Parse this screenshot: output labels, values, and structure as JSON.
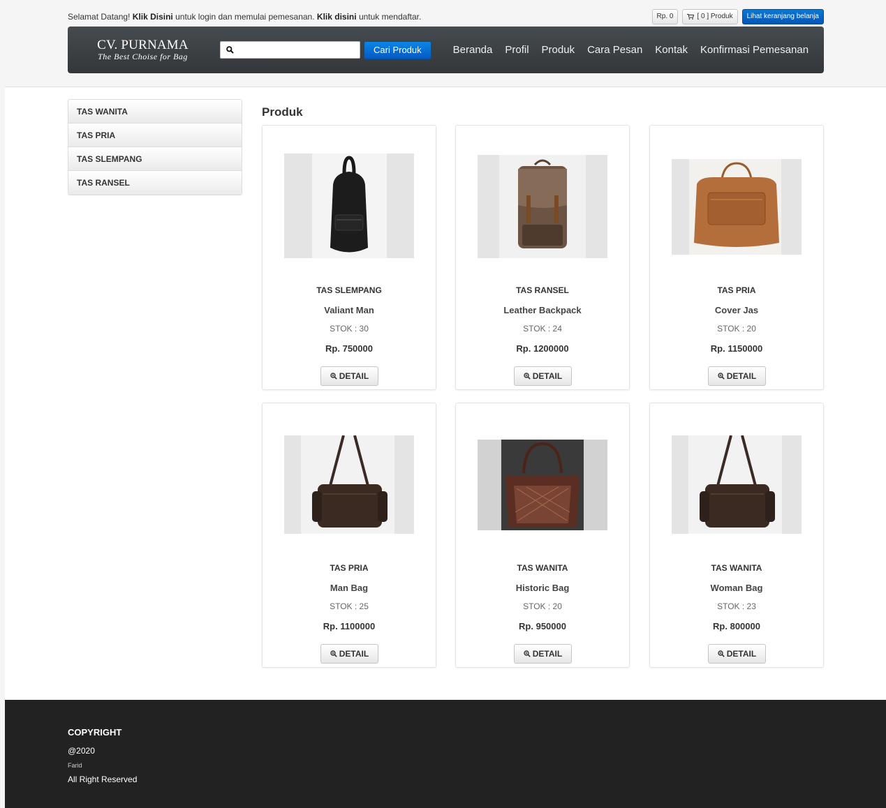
{
  "topbar": {
    "welcome_prefix": "Selamat Datang!",
    "login_link": "Klik Disini",
    "login_suffix": "untuk login dan memulai pemesanan.",
    "register_link": "Klik disini",
    "register_suffix": "untuk mendaftar.",
    "cart_total": "Rp. 0",
    "cart_count": "[ 0 ] Produk",
    "view_cart": "Lihat keranjang belanja"
  },
  "navbar": {
    "brand_name": "CV. PURNAMA",
    "brand_tagline": "The Best Choise for Bag",
    "search_value": "",
    "search_placeholder": "",
    "search_button": "Cari Produk",
    "links": [
      "Beranda",
      "Profil",
      "Produk",
      "Cara Pesan",
      "Kontak",
      "Konfirmasi Pemesanan"
    ]
  },
  "sidebar": {
    "items": [
      "TAS WANITA",
      "TAS PRIA",
      "TAS SLEMPANG",
      "TAS RANSEL"
    ]
  },
  "main": {
    "title": "Produk",
    "detail_label": "DETAIL",
    "products": [
      {
        "category": "TAS SLEMPANG",
        "name": "Valiant Man",
        "stock": "STOK : 30",
        "price": "Rp. 750000"
      },
      {
        "category": "TAS RANSEL",
        "name": "Leather Backpack",
        "stock": "STOK : 24",
        "price": "Rp. 1200000"
      },
      {
        "category": "TAS PRIA",
        "name": "Cover Jas",
        "stock": "STOK : 20",
        "price": "Rp. 1150000"
      },
      {
        "category": "TAS PRIA",
        "name": "Man Bag",
        "stock": "STOK : 25",
        "price": "Rp. 1100000"
      },
      {
        "category": "TAS WANITA",
        "name": "Historic Bag",
        "stock": "STOK : 20",
        "price": "Rp. 950000"
      },
      {
        "category": "TAS WANITA",
        "name": "Woman Bag",
        "stock": "STOK : 23",
        "price": "Rp. 800000"
      }
    ]
  },
  "footer": {
    "title": "COPYRIGHT",
    "year": "@2020",
    "author": "Farid",
    "rights": "All Right Reserved"
  },
  "colors": {
    "navbar": "#3d4144",
    "primary_button": "#0a6fd0",
    "footer": "#222222"
  }
}
